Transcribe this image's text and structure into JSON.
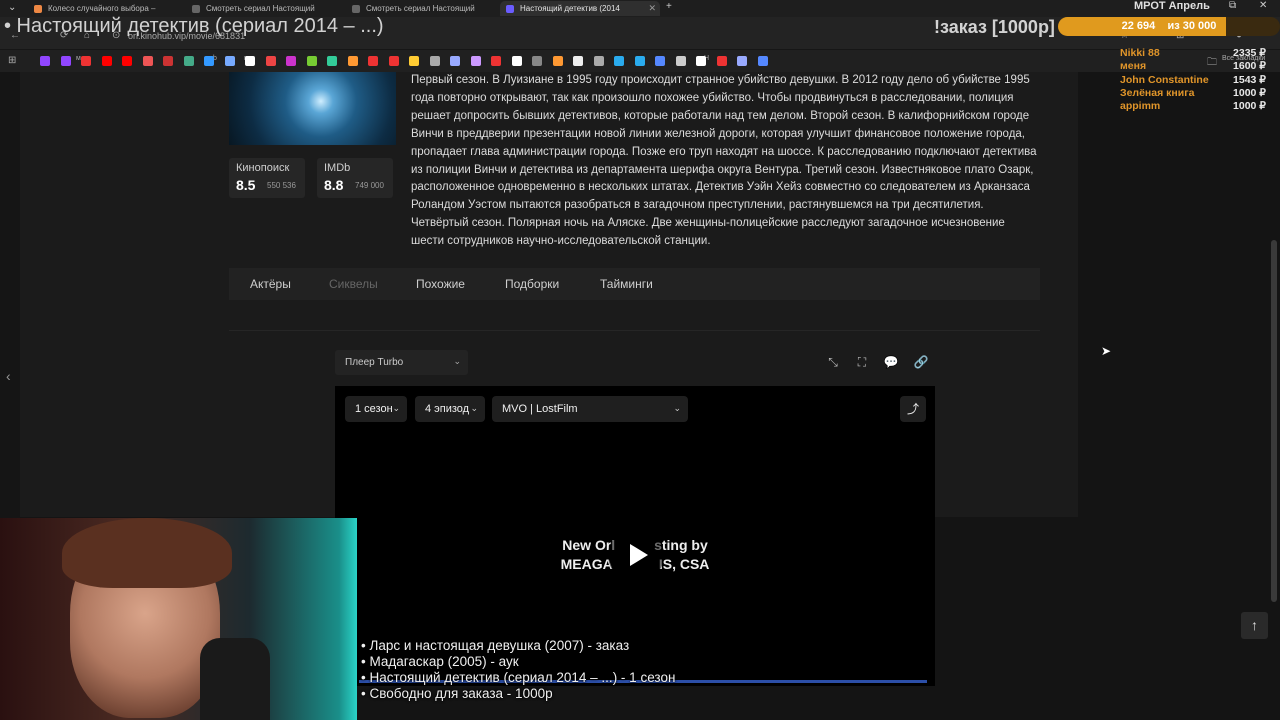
{
  "browser": {
    "tabs": [
      {
        "label": "Колесо случайного выбора – ",
        "active": false
      },
      {
        "label": "Смотреть сериал Настоящий ",
        "active": false
      },
      {
        "label": "Смотреть сериал Настоящий ",
        "active": false
      },
      {
        "label": "Настоящий детектив (2014 ",
        "active": true
      }
    ],
    "new_tab": "+",
    "url": "orl.kinohub.vip/movie/681831",
    "bookmarks_label": "Все закладки",
    "bookmark_icons": [
      "twitch-icon",
      "twitch-icon",
      "mail-icon",
      "youtube-icon",
      "youtube-icon",
      "mail-icon",
      "bookmark-icon",
      "bookmark-icon",
      "bookmark-icon",
      "bookmark-icon",
      "bookmark-icon",
      "bookmark-icon",
      "bookmark-icon",
      "bookmark-icon",
      "bookmark-icon",
      "bookmark-icon",
      "bookmark-icon",
      "bookmark-icon",
      "bookmark-icon",
      "bookmark-icon",
      "bookmark-icon",
      "bookmark-icon",
      "bookmark-icon",
      "bookmark-icon",
      "bookmark-icon",
      "bookmark-icon",
      "bookmark-icon",
      "bookmark-icon",
      "telegram-icon",
      "telegram-icon",
      "bookmark-icon",
      "bookmark-icon",
      "bookmark-icon",
      "bookmark-icon",
      "bookmark-icon",
      "bookmark-icon"
    ],
    "bookmark_text": {
      "m1": "м",
      "b": "b",
      "m2": "m",
      "h": "H"
    }
  },
  "stream": {
    "title": "• Настоящий детектив (сериал 2014 – ...)",
    "order_label": "!заказ [1000р]",
    "goal": {
      "title": "МРОТ Апрель",
      "current": "22 694",
      "target_text": "из 30 000",
      "progress": 0.7565
    },
    "donors": [
      {
        "name": "Nikki 88",
        "amount": "2335 ₽"
      },
      {
        "name": "меня",
        "amount": "1600 ₽"
      },
      {
        "name": "John Constantine",
        "amount": "1543 ₽"
      },
      {
        "name": "Зелёная книга",
        "amount": "1000 ₽"
      },
      {
        "name": "appimm",
        "amount": "1000 ₽"
      }
    ],
    "queue": [
      "• Ларс и настоящая девушка (2007) - заказ",
      "• Мадагаскар (2005) - аук",
      "• Настоящий детектив (сериал 2014 – ...) - 1 сезон",
      "• Свободно для заказа - 1000р"
    ]
  },
  "movie": {
    "ratings": [
      {
        "source": "Кинопоиск",
        "value": "8.5",
        "count": "550 536"
      },
      {
        "source": "IMDb",
        "value": "8.8",
        "count": "749 000"
      }
    ],
    "description": "Первый сезон. В Луизиане в 1995 году происходит странное убийство девушки. В 2012 году дело об убийстве 1995 года повторно открывают, так как произошло похожее убийство. Чтобы продвинуться в расследовании, полиция решает допросить бывших детективов, которые работали над тем делом. Второй сезон. В калифорнийском городе Винчи в преддверии презентации новой линии железной дороги, которая улучшит финансовое положение города, пропадает глава администрации города. Позже его труп находят на шоссе. К расследованию подключают детектива из полиции Винчи и детектива из департамента шерифа округа Вентура. Третий сезон. Известняковое плато Озарк, расположенное одновременно в нескольких штатах. Детектив Уэйн Хейз совместно со следователем из Арканзаса Роландом Уэстом пытаются разобраться в загадочном преступлении, растянувшемся на три десятилетия. Четвёртый сезон. Полярная ночь на Аляске. Две женщины-полицейские расследуют загадочное исчезновение шести сотрудников научно-исследовательской станции.",
    "tabs": [
      "Актёры",
      "Сиквелы",
      "Похожие",
      "Подборки",
      "Тайминги"
    ]
  },
  "player": {
    "source_select": "Плеер Turbo",
    "season": "1 сезон",
    "episode": "4 эпизод",
    "voice": "MVO | LostFilm",
    "credits_line1": "New Orl          sting by",
    "credits_line2": "MEAGA            IS, CSA"
  }
}
